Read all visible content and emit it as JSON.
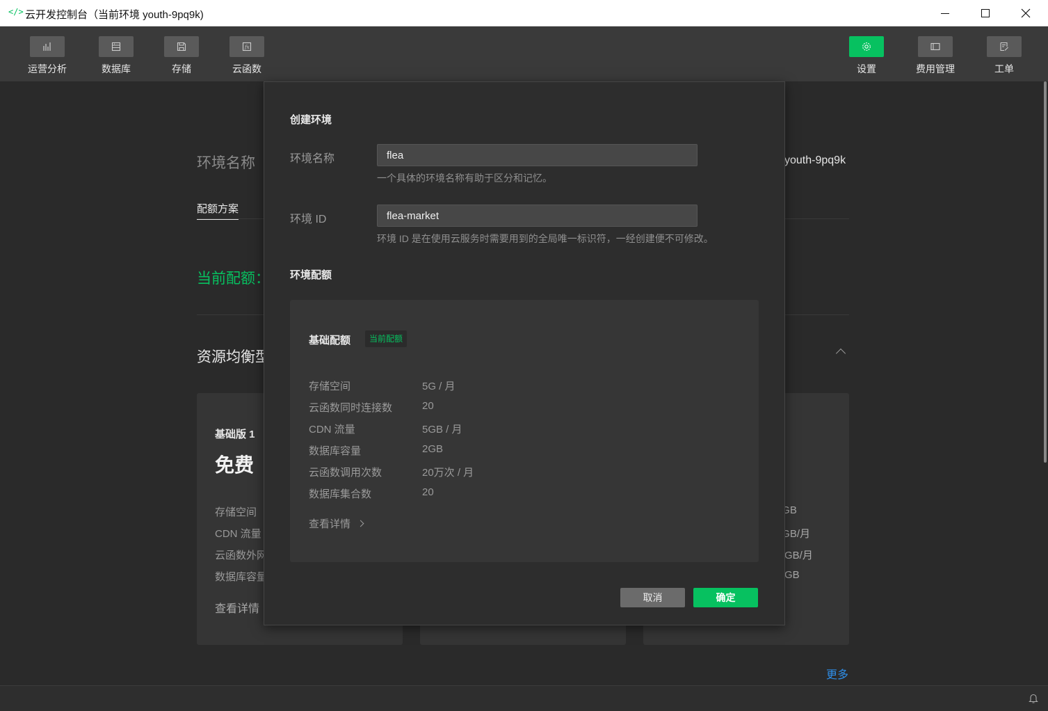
{
  "window": {
    "title": "云开发控制台（当前环境 youth-9pq9k)",
    "app_icon": "</>"
  },
  "toolbar": {
    "left": [
      {
        "label": "运营分析",
        "icon": "bar-chart-icon"
      },
      {
        "label": "数据库",
        "icon": "database-icon"
      },
      {
        "label": "存储",
        "icon": "storage-icon"
      },
      {
        "label": "云函数",
        "icon": "function-icon"
      }
    ],
    "right": [
      {
        "label": "设置",
        "icon": "gear-icon",
        "active": true
      },
      {
        "label": "费用管理",
        "icon": "billing-icon"
      },
      {
        "label": "工单",
        "icon": "ticket-icon"
      }
    ],
    "active_color": "#07c160"
  },
  "background": {
    "env_name_label": "环境名称",
    "env_id_value": "youth-9pq9k",
    "tab": "配额方案",
    "current_quota": "当前配额：",
    "plan_type": "资源均衡型",
    "card1": {
      "plan": "基础版 1",
      "price": "免费",
      "rows": [
        "存储空间",
        "CDN 流量",
        "云函数外网",
        "数据库容量"
      ],
      "more": "查看详情"
    },
    "card3_values": [
      ") GB",
      ") GB/月",
      "GB/月",
      "GB"
    ],
    "more_link": "更多"
  },
  "modal": {
    "title": "创建环境",
    "env_name": {
      "label": "环境名称",
      "value": "flea",
      "hint": "一个具体的环境名称有助于区分和记忆。"
    },
    "env_id": {
      "label": "环境 ID",
      "value": "flea-market",
      "hint": "环境 ID 是在使用云服务时需要用到的全局唯一标识符，一经创建便不可修改。"
    },
    "quota_section": "环境配额",
    "quota": {
      "name": "基础配额",
      "badge": "当前配额",
      "items": [
        {
          "key": "存储空间",
          "value": "5G / 月"
        },
        {
          "key": "云函数同时连接数",
          "value": "20"
        },
        {
          "key": "CDN 流量",
          "value": "5GB / 月"
        },
        {
          "key": "数据库容量",
          "value": "2GB"
        },
        {
          "key": "云函数调用次数",
          "value": "20万次 / 月"
        },
        {
          "key": "数据库集合数",
          "value": "20"
        }
      ],
      "detail": "查看详情"
    },
    "cancel_label": "取消",
    "ok_label": "确定"
  }
}
